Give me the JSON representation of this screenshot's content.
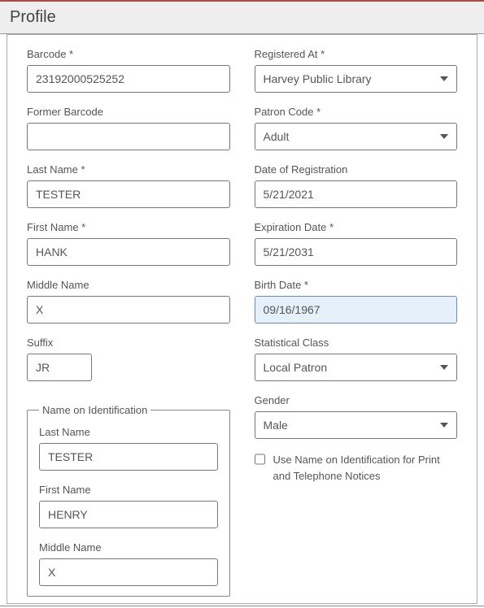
{
  "header": {
    "title": "Profile"
  },
  "left": {
    "barcode": {
      "label": "Barcode *",
      "value": "23192000525252"
    },
    "former_barcode": {
      "label": "Former Barcode",
      "value": ""
    },
    "last_name": {
      "label": "Last Name *",
      "value": "TESTER"
    },
    "first_name": {
      "label": "First Name *",
      "value": "HANK"
    },
    "middle_name": {
      "label": "Middle Name",
      "value": "X"
    },
    "suffix": {
      "label": "Suffix",
      "value": "JR"
    },
    "id_group": {
      "legend": "Name on Identification",
      "last_name": {
        "label": "Last Name",
        "value": "TESTER"
      },
      "first_name": {
        "label": "First Name",
        "value": "HENRY"
      },
      "middle_name": {
        "label": "Middle Name",
        "value": "X"
      }
    }
  },
  "right": {
    "registered_at": {
      "label": "Registered At *",
      "value": "Harvey Public Library"
    },
    "patron_code": {
      "label": "Patron Code *",
      "value": "Adult"
    },
    "date_of_registration": {
      "label": "Date of Registration",
      "value": "5/21/2021"
    },
    "expiration_date": {
      "label": "Expiration Date *",
      "value": "5/21/2031"
    },
    "birth_date": {
      "label": "Birth Date *",
      "value": "09/16/1967"
    },
    "statistical_class": {
      "label": "Statistical Class",
      "value": "Local Patron"
    },
    "gender": {
      "label": "Gender",
      "value": "Male"
    },
    "use_name_on_id": {
      "label": "Use Name on Identification for Print and Telephone Notices",
      "checked": false
    }
  }
}
